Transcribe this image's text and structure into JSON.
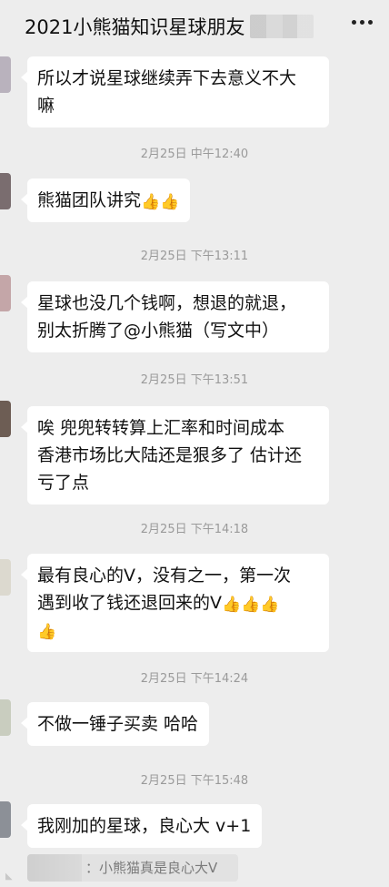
{
  "header": {
    "title": "2021小熊猫知识星球朋友"
  },
  "messages": [
    {
      "text": "所以才说星球继续弄下去意义不大嘛",
      "line1": "所以才说星球继续弄下去意义不大",
      "line2": "嘛"
    },
    {
      "time": "2月25日 中午12:40",
      "text": "熊猫团队讲究",
      "emoji": "👍👍"
    },
    {
      "time": "2月25日 下午13:11",
      "line1": "星球也没几个钱啊，想退的就退，",
      "line2": "别太折腾了@小熊猫（写文中）"
    },
    {
      "time": "2月25日 下午13:51",
      "line1": "唉 兜兜转转算上汇率和时间成本",
      "line2": "香港市场比大陆还是狠多了 估计还",
      "line3": "亏了点"
    },
    {
      "time": "2月25日 下午14:18",
      "line1": "最有良心的V，没有之一，第一次",
      "line2": "遇到收了钱还退回来的V",
      "emoji_inline": "👍👍👍",
      "emoji_line3": "👍"
    },
    {
      "time": "2月25日 下午14:24",
      "text": "不做一锤子买卖 哈哈"
    },
    {
      "time": "2月25日 下午15:48",
      "text": "我刚加的星球，良心大 v+1"
    }
  ],
  "quote": {
    "text": "：小熊猫真是良心大V"
  },
  "colors": {
    "bubble": "#ffffff",
    "background": "#ededed",
    "timestamp": "#9a9a9a"
  }
}
